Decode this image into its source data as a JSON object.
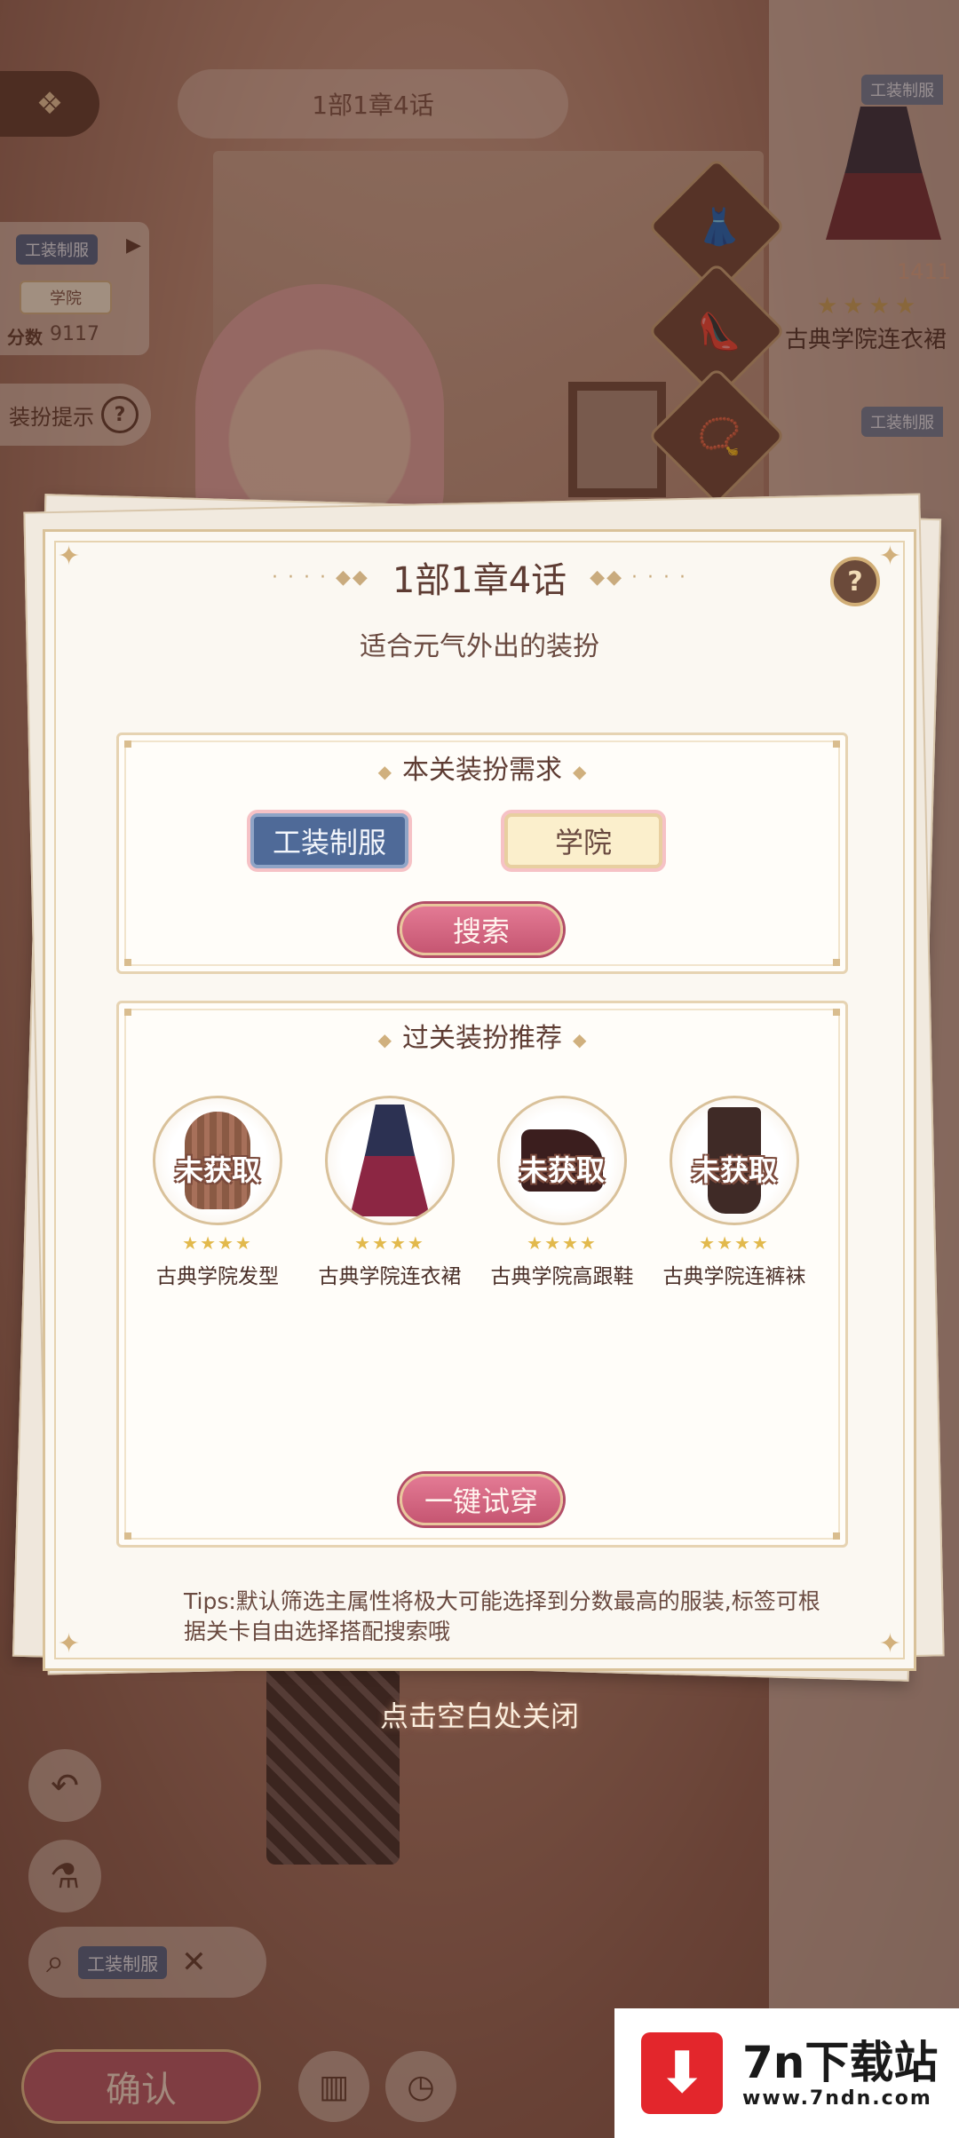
{
  "scene": {
    "chapter": "1部1章4话",
    "left_panel": {
      "type_tag": "工装制服",
      "style_tag": "学院",
      "score_label": "分数",
      "score": "9117"
    },
    "hint_label": "装扮提示",
    "right_column": {
      "tag1": "工装制服",
      "item_num": "1411",
      "item_name": "古典学院连衣裙",
      "tag2": "工装制服"
    },
    "search_tag": "工装制服",
    "confirm_label": "确认"
  },
  "dialog": {
    "title": "1部1章4话",
    "subtitle": "适合元气外出的装扮",
    "requirements": {
      "title": "本关装扮需求",
      "tags": [
        "工装制服",
        "学院"
      ],
      "search_label": "搜索"
    },
    "recommend": {
      "title": "过关装扮推荐",
      "items": [
        {
          "name": "古典学院发型",
          "status": "未获取",
          "stars": 4,
          "art": "hair"
        },
        {
          "name": "古典学院连衣裙",
          "status": "",
          "stars": 4,
          "art": "dress"
        },
        {
          "name": "古典学院高跟鞋",
          "status": "未获取",
          "stars": 4,
          "art": "shoe"
        },
        {
          "name": "古典学院连裤袜",
          "status": "未获取",
          "stars": 4,
          "art": "sock"
        }
      ],
      "try_on_label": "一键试穿"
    },
    "tips": "Tips:默认筛选主属性将极大可能选择到分数最高的服装,标签可根据关卡自由选择搭配搜索哦",
    "close_hint": "点击空白处关闭"
  },
  "watermark": {
    "brand": "7n下载站",
    "url": "www.7ndn.com"
  },
  "colors": {
    "accent_pink": "#c65672",
    "tag_blue": "#4f6a98",
    "gold": "#d1ae76"
  }
}
